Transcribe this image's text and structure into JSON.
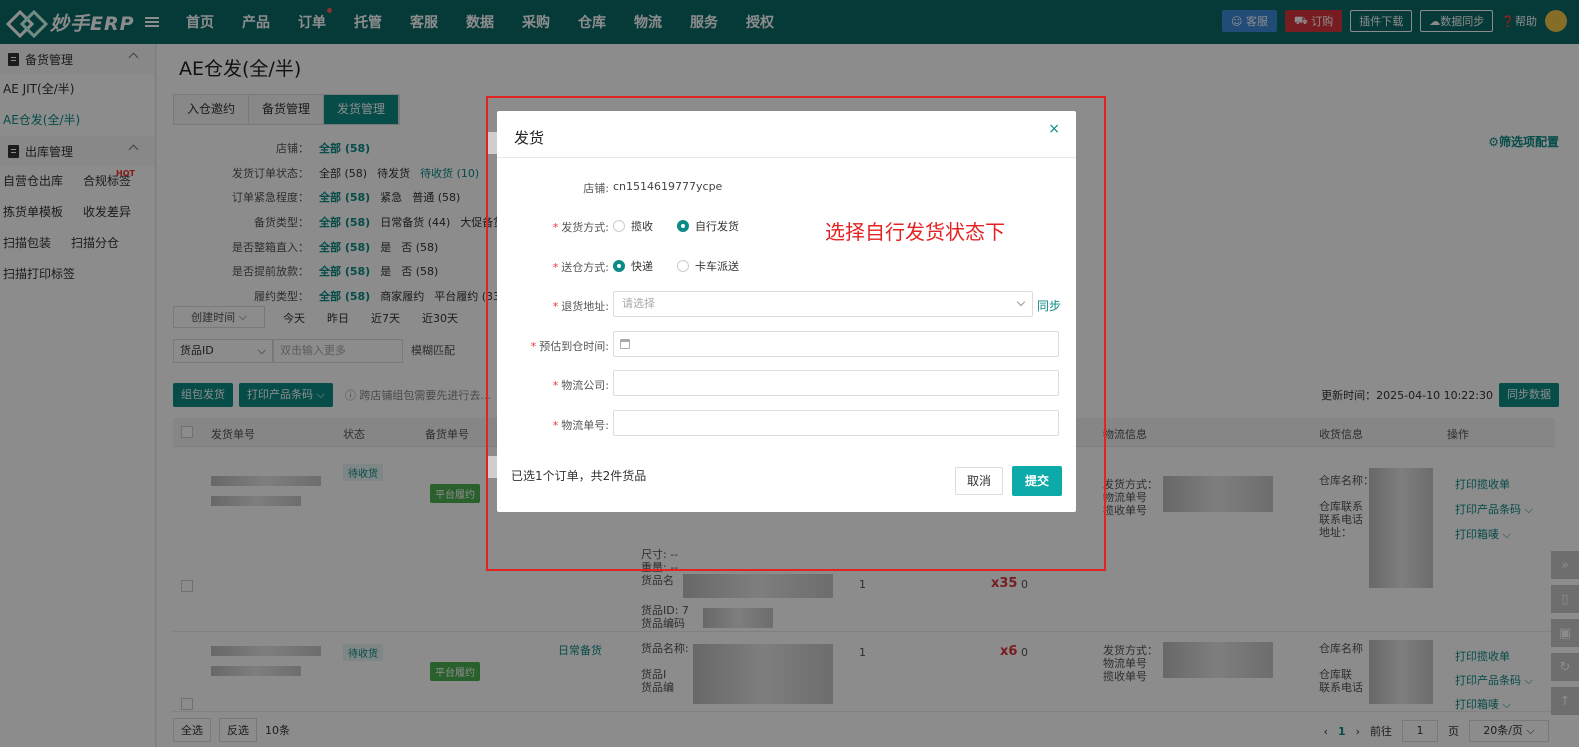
{
  "topbar": {
    "logo": "妙手ERP",
    "nav": [
      "首页",
      "产品",
      "订单",
      "托管",
      "客服",
      "数据",
      "采购",
      "仓库",
      "物流",
      "服务",
      "授权"
    ],
    "buttons": {
      "kefu": "客服",
      "dinggou": "订购",
      "plugin": "插件下载",
      "sync": "数据同步",
      "help": "帮助"
    }
  },
  "sidebar": {
    "group1": "备货管理",
    "item_jit": "AE JIT(全/半)",
    "item_ae": "AE仓发(全/半)",
    "group2": "出库管理",
    "item_self": "自营仓出库",
    "item_label": "合规标签",
    "hot": "HOT",
    "item_pick": "拣货单模板",
    "item_diff": "收发差异",
    "item_scanpack": "扫描包装",
    "item_scansplit": "扫描分仓",
    "item_scanprint": "扫描打印标签"
  },
  "main": {
    "title": "AE仓发(全/半)",
    "tabs": [
      "入仓邀约",
      "备货管理",
      "发货管理"
    ],
    "filter_config": "筛选项配置",
    "filters": [
      {
        "label": "店铺：",
        "values": [
          "全部 (58)"
        ]
      },
      {
        "label": "发货订单状态：",
        "values": [
          "全部 (58)",
          "待发货",
          "待收货 (10)"
        ]
      },
      {
        "label": "订单紧急程度：",
        "values": [
          "全部 (58)",
          "紧急",
          "普通 (58)"
        ]
      },
      {
        "label": "备货类型：",
        "values": [
          "全部 (58)",
          "日常备货 (44)",
          "大促备货"
        ]
      },
      {
        "label": "是否整箱直入：",
        "values": [
          "全部 (58)",
          "是",
          "否 (58)"
        ]
      },
      {
        "label": "是否提前放款：",
        "values": [
          "全部 (58)",
          "是",
          "否 (58)"
        ]
      },
      {
        "label": "履约类型：",
        "values": [
          "全部 (58)",
          "商家履约",
          "平台履约 (33)"
        ]
      }
    ],
    "date_select": "创建时间",
    "quick_dates": [
      "今天",
      "昨日",
      "近7天",
      "近30天"
    ],
    "search_select": "货品ID",
    "search_placeholder": "双击输入更多",
    "search_mode": "模糊匹配",
    "actions": {
      "combine": "组包发货",
      "print_barcode": "打印产品条码",
      "tip": "跨店铺组包需要先进行去..."
    },
    "update_time_label": "更新时间：2025-04-10 10:22:30",
    "sync_button": "同步数据",
    "columns": {
      "order_no": "发货单号",
      "status": "状态",
      "stock_no": "备货单号",
      "logistics": "物流信息",
      "receive": "收货信息",
      "ops": "操作"
    },
    "rows": [
      {
        "status": "待收货",
        "type_badge": "平台履约",
        "qty": "x35",
        "count_a": "1",
        "count_b": "0",
        "goods_lines": [
          "尺寸: --",
          "重量: --",
          "货品名",
          "货品ID: 7",
          "货品编码",
          "尺寸"
        ],
        "logistics_lines": [
          "发货方式：",
          "物流单号",
          "揽收单号"
        ],
        "receive_lines": [
          "仓库名称：",
          "仓库联系",
          "联系电话",
          "地址："
        ],
        "ops": [
          "打印揽收单",
          "打印产品条码",
          "打印箱唛"
        ]
      },
      {
        "status": "待收货",
        "type_badge": "平台履约",
        "stock_type": "日常备货",
        "qty": "x6",
        "count_a": "1",
        "count_b": "0",
        "goods_lines": [
          "货品名称: ",
          "货品I",
          "货品编"
        ],
        "logistics_lines": [
          "发货方式：",
          "物流单号",
          "揽收单号"
        ],
        "receive_lines": [
          "仓库名称",
          "仓库联",
          "联系电话"
        ],
        "ops": [
          "打印揽收单",
          "打印产品条码",
          "打印箱唛"
        ]
      }
    ],
    "footer": {
      "select_all": "全选",
      "invert": "反选",
      "count": "10条"
    },
    "pager": {
      "current": "1",
      "goto": "前往",
      "page_input": "1",
      "page_unit": "页",
      "page_size": "20条/页"
    }
  },
  "dialog": {
    "title": "发货",
    "close": "×",
    "store_label": "店铺:",
    "store_value": "cn1514619777ycpe",
    "ship_method_label": "发货方式:",
    "ship_options": [
      "揽收",
      "自行发货"
    ],
    "ship_selected": "自行发货",
    "deliver_label": "送仓方式:",
    "deliver_options": [
      "快递",
      "卡车派送"
    ],
    "deliver_selected": "快递",
    "return_label": "退货地址:",
    "return_placeholder": "请选择",
    "sync_link": "同步",
    "eta_label": "预估到仓时间:",
    "company_label": "物流公司:",
    "tracking_label": "物流单号:",
    "selected_info": "已选1个订单，共2件货品",
    "cancel": "取消",
    "submit": "提交"
  },
  "annotation": {
    "text": "选择自行发货状态下",
    "color": "#e32323"
  },
  "colors": {
    "brand": "#0c6b69",
    "accent": "#0c8a86",
    "submit": "#0cabaa"
  }
}
